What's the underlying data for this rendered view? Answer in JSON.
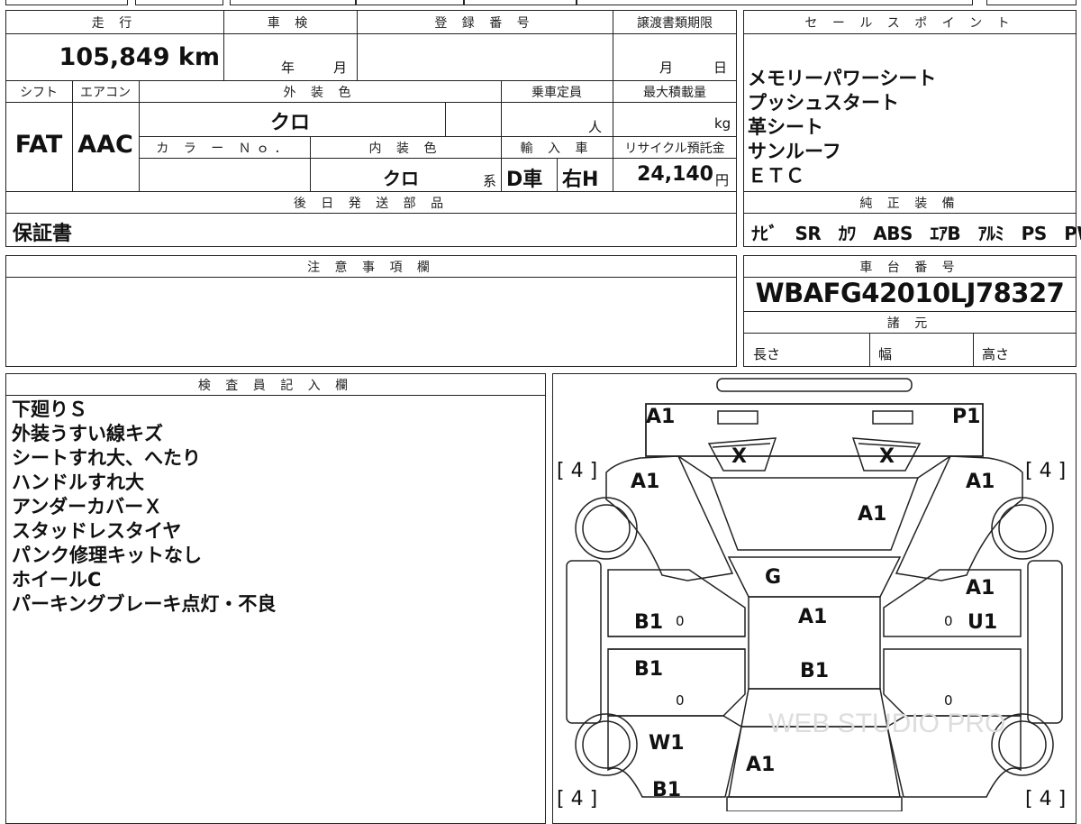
{
  "header": {
    "mileage_label": "走 行",
    "mileage_value": "105,849 km",
    "inspection_label": "車 検",
    "inspection_year": "年",
    "inspection_month": "月",
    "registration_label": "登 録 番 号",
    "transfer_label": "譲渡書類期限",
    "transfer_month": "月",
    "transfer_day": "日"
  },
  "specs": {
    "shift_label": "シフト",
    "shift_value": "FAT",
    "aircon_label": "エアコン",
    "aircon_value": "AAC",
    "exterior_color_label": "外 装 色",
    "exterior_color_value": "クロ",
    "capacity_label": "乗車定員",
    "capacity_unit": "人",
    "max_load_label": "最大積載量",
    "max_load_unit": "kg",
    "color_no_label": "カ ラ ー Ｎｏ．",
    "interior_color_label": "内 装 色",
    "interior_color_value": "クロ",
    "interior_color_suffix": "系",
    "import_label": "輸 入 車",
    "import_value": "D車",
    "steering_value": "右H",
    "recycle_label": "リサイクル預託金",
    "recycle_value": "24,140",
    "recycle_unit": "円"
  },
  "later_parts": {
    "label": "後 日 発 送 部 品",
    "value": "保証書"
  },
  "sales_points": {
    "label": "セ ー ル ス ポ イ ン ト",
    "items": [
      "メモリーパワーシート",
      "プッシュスタート",
      "革シート",
      "サンルーフ",
      "ＥＴＣ"
    ]
  },
  "equipment": {
    "label": "純 正 装 備",
    "value": "ﾅﾋﾞ　SR　ｶﾜ　ABS　ｴｱB　ｱﾙﾐ　PS　PW"
  },
  "notes": {
    "label": "注 意 事 項 欄",
    "value": ""
  },
  "chassis": {
    "label": "車 台 番 号",
    "value": "WBAFG42010LJ78327",
    "specs_label": "諸 元",
    "length_label": "長さ",
    "width_label": "幅",
    "height_label": "高さ"
  },
  "inspector": {
    "label": "検 査 員 記 入 欄",
    "lines": [
      "下廻りＳ",
      "外装うすい線キズ",
      "シートすれ大、へたり",
      "ハンドルすれ大",
      "アンダーカバーＸ",
      "スタッドレスタイヤ",
      "パンク修理キットなし",
      "ホイールC",
      "パーキングブレーキ点灯・不良"
    ]
  },
  "diagram": {
    "marks": {
      "front_left": "A1",
      "front_right": "P1",
      "light_left": "X",
      "light_right": "X",
      "fender_fl": "A1",
      "fender_fr": "A1",
      "hood": "A1",
      "windshield": "G",
      "door_fr_a": "A1",
      "roof": "A1",
      "door_fl": "B1",
      "door_fr_u": "U1",
      "door_rl": "B1",
      "roof_rear": "B1",
      "quarter_rl": "W1",
      "trunk": "A1",
      "rear_bumper": "B1"
    },
    "tires": {
      "fl": "[ 4 ]",
      "fr": "[ 4 ]",
      "rl": "[ 4 ]",
      "rr": "[ 4 ]"
    },
    "zeros": [
      "0",
      "0",
      "0",
      "0"
    ],
    "watermark": "WEB STUDIO PRO"
  }
}
